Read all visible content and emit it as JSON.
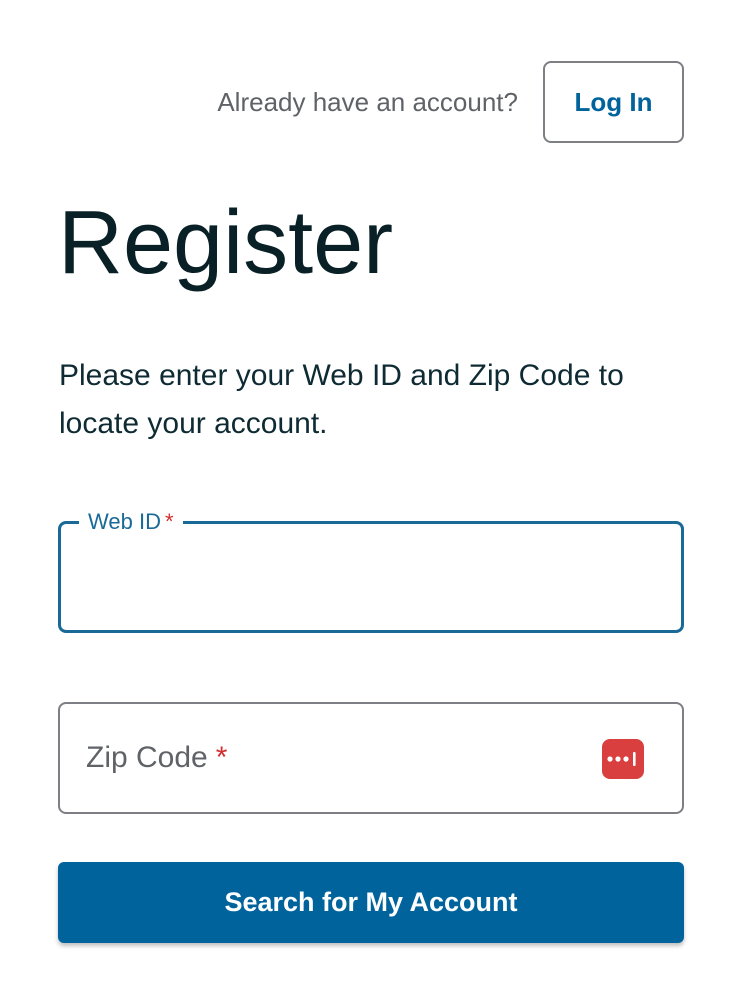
{
  "header": {
    "prompt_text": "Already have an account?",
    "login_label": "Log In"
  },
  "page": {
    "title": "Register",
    "instructions": "Please enter your Web ID and Zip Code to locate your account."
  },
  "form": {
    "web_id": {
      "label": "Web ID",
      "required_marker": "*",
      "value": ""
    },
    "zip_code": {
      "label": "Zip Code",
      "required_marker": "*",
      "value": "",
      "autofill_icon": "password-manager-icon"
    },
    "submit_label": "Search for My Account"
  },
  "colors": {
    "primary": "#00639c",
    "focus_border": "#1a6a98",
    "required": "#d32f2f",
    "autofill_icon_bg": "#d93f3f"
  }
}
